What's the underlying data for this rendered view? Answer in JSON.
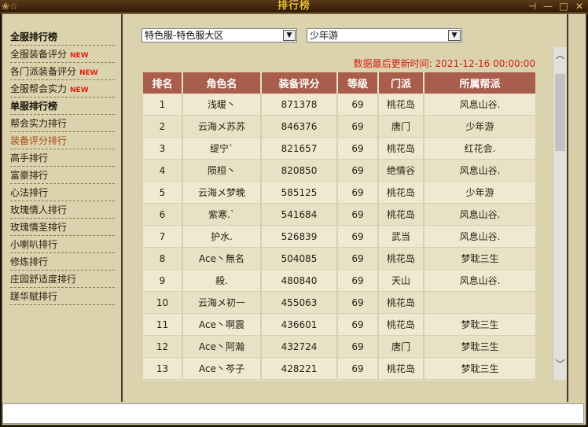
{
  "window": {
    "title": "排行榜",
    "deco": "❀☆"
  },
  "sidebar": {
    "items": [
      {
        "label": "全服排行榜",
        "type": "header"
      },
      {
        "label": "全服装备评分",
        "new": "NEW"
      },
      {
        "label": "各门派装备评分",
        "new": "NEW"
      },
      {
        "label": "全服帮会实力",
        "new": "NEW"
      },
      {
        "label": "单服排行榜",
        "type": "header"
      },
      {
        "label": "帮会实力排行"
      },
      {
        "label": "装备评分排行",
        "active": true
      },
      {
        "label": "高手排行"
      },
      {
        "label": "富豪排行"
      },
      {
        "label": "心法排行"
      },
      {
        "label": "玫瑰情人排行"
      },
      {
        "label": "玫瑰情圣排行"
      },
      {
        "label": "小喇叭排行"
      },
      {
        "label": "修炼排行"
      },
      {
        "label": "庄园舒适度排行"
      },
      {
        "label": "蹉华赋排行"
      }
    ]
  },
  "filters": {
    "server": "特色服-特色服大区",
    "server_group": "少年游"
  },
  "update": {
    "label": "数据最后更新时间:",
    "time": "2021-12-16 00:00:00"
  },
  "table": {
    "headers": [
      "排名",
      "角色名",
      "装备评分",
      "等级",
      "门派",
      "所属帮派"
    ],
    "rows": [
      [
        "1",
        "浅暖丶",
        "871378",
        "69",
        "桃花岛",
        "风息山谷."
      ],
      [
        "2",
        "云海メ苏苏",
        "846376",
        "69",
        "唐门",
        "少年游"
      ],
      [
        "3",
        "缇宁`",
        "821657",
        "69",
        "桃花岛",
        "红花会."
      ],
      [
        "4",
        "陨桓丶",
        "820850",
        "69",
        "绝情谷",
        "风息山谷."
      ],
      [
        "5",
        "云海メ梦晚",
        "585125",
        "69",
        "桃花岛",
        "少年游"
      ],
      [
        "6",
        "紫寒.`",
        "541684",
        "69",
        "桃花岛",
        "风息山谷."
      ],
      [
        "7",
        "护水.",
        "526839",
        "69",
        "武当",
        "风息山谷."
      ],
      [
        "8",
        "Ace丶無名",
        "504085",
        "69",
        "桃花岛",
        "梦耽三生"
      ],
      [
        "9",
        "殺.",
        "480840",
        "69",
        "天山",
        "风息山谷."
      ],
      [
        "10",
        "云海メ初一",
        "455063",
        "69",
        "桃花岛",
        ""
      ],
      [
        "11",
        "Ace丶啊震",
        "436601",
        "69",
        "桃花岛",
        "梦耽三生"
      ],
      [
        "12",
        "Ace丶阿瀚",
        "432724",
        "69",
        "唐门",
        "梦耽三生"
      ],
      [
        "13",
        "Ace丶芩子",
        "428221",
        "69",
        "桃花岛",
        "梦耽三生"
      ]
    ]
  },
  "colors": {
    "header_bg": "#a95e4c",
    "update_text": "#d02010",
    "new_tag": "#e02010",
    "active_item": "#a84a10"
  },
  "icons": {
    "pin": "pin-icon",
    "minimize": "minimize-icon",
    "maximize": "maximize-icon",
    "close": "close-icon",
    "dropdown": "chevron-down-icon",
    "scroll_up": "chevron-up-icon",
    "scroll_down": "chevron-down-icon"
  }
}
